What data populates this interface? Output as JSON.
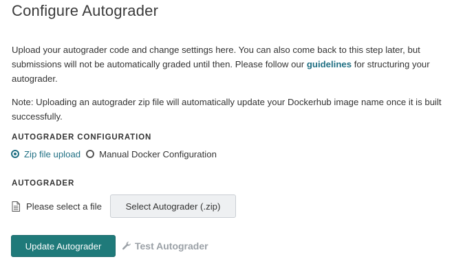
{
  "page": {
    "title": "Configure Autograder"
  },
  "intro": {
    "text_before_link": "Upload your autograder code and change settings here. You can also come back to this step later, but submissions will not be automatically graded until then. Please follow our ",
    "link_label": "guidelines",
    "text_after_link": " for structuring your autograder."
  },
  "note": {
    "text": "Note: Uploading an autograder zip file will automatically update your Dockerhub image name once it is built successfully."
  },
  "config_section": {
    "label": "AUTOGRADER CONFIGURATION",
    "options": [
      {
        "label": "Zip file upload",
        "selected": true
      },
      {
        "label": "Manual Docker Configuration",
        "selected": false
      }
    ]
  },
  "autograder_section": {
    "label": "AUTOGRADER",
    "file_icon": "document-icon",
    "file_placeholder": "Please select a file",
    "select_button_label": "Select Autograder (.zip)"
  },
  "actions": {
    "update_button_label": "Update Autograder",
    "test_button_label": "Test Autograder",
    "test_icon": "wrench-icon"
  },
  "colors": {
    "accent": "#1f6f83",
    "primary_button": "#1f7a7a",
    "disabled_text": "#9aa0a6",
    "secondary_button_bg": "#eef0f2"
  }
}
